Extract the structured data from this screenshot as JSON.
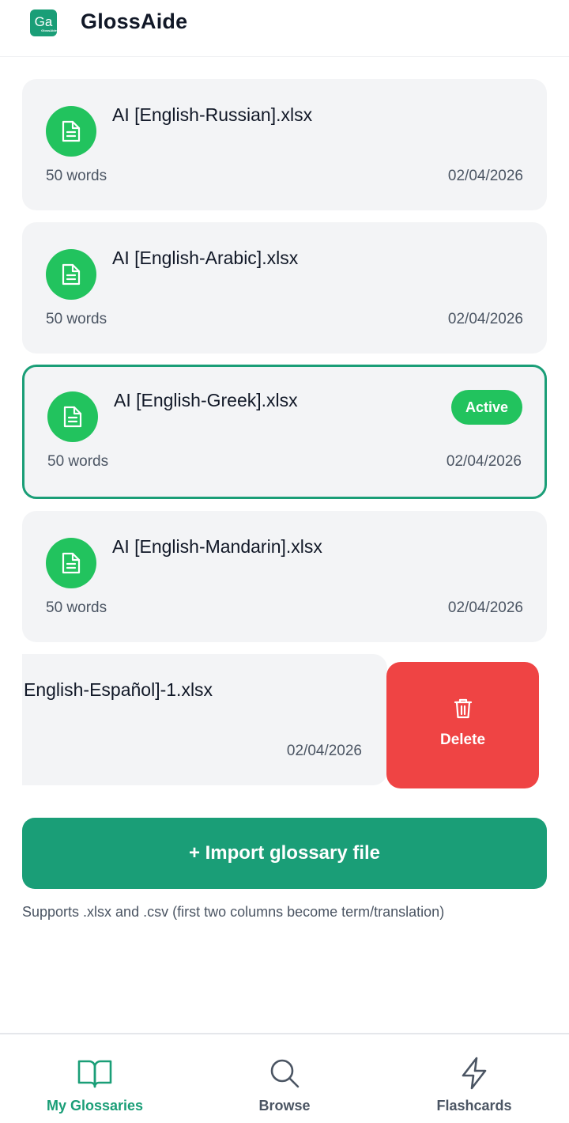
{
  "header": {
    "logo_text": "Ga",
    "logo_subtext": "GlossAide",
    "title": "GlossAide"
  },
  "glossaries": [
    {
      "title": "AI [English-Russian].xlsx",
      "words": "50 words",
      "date": "02/04/2026",
      "active": false
    },
    {
      "title": "AI [English-Arabic].xlsx",
      "words": "50 words",
      "date": "02/04/2026",
      "active": false
    },
    {
      "title": "AI [English-Greek].xlsx",
      "words": "50 words",
      "date": "02/04/2026",
      "active": true
    },
    {
      "title": "AI [English-Mandarin].xlsx",
      "words": "50 words",
      "date": "02/04/2026",
      "active": false
    }
  ],
  "active_badge": "Active",
  "swiped_item": {
    "title": "English-Español]-1.xlsx",
    "date": "02/04/2026",
    "delete_label": "Delete"
  },
  "import": {
    "button_label": "+ Import glossary file",
    "note": "Supports .xlsx and .csv (first two columns become term/translation)"
  },
  "nav": [
    {
      "label": "My Glossaries",
      "icon": "book-open-icon",
      "selected": true
    },
    {
      "label": "Browse",
      "icon": "search-icon",
      "selected": false
    },
    {
      "label": "Flashcards",
      "icon": "lightning-icon",
      "selected": false
    }
  ],
  "colors": {
    "brand": "#1a9e77",
    "accent_green": "#22c35e",
    "danger": "#ef4444",
    "card_bg": "#f3f4f6"
  }
}
